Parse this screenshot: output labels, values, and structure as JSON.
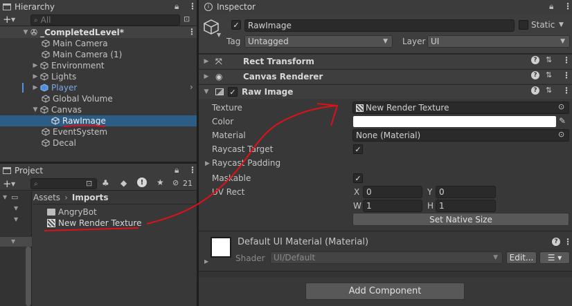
{
  "hierarchy": {
    "tab": "Hierarchy",
    "search_placeholder": "All",
    "scene": "_CompletedLevel*",
    "items": [
      {
        "label": "Main Camera"
      },
      {
        "label": "Main Camera (1)"
      },
      {
        "label": "Environment"
      },
      {
        "label": "Lights"
      },
      {
        "label": "Player"
      },
      {
        "label": "Global Volume"
      },
      {
        "label": "Canvas"
      },
      {
        "label": "RawImage"
      },
      {
        "label": "EventSystem"
      },
      {
        "label": "Decal"
      }
    ]
  },
  "project": {
    "tab": "Project",
    "hidden_count": "21",
    "breadcrumb": {
      "root": "Assets",
      "sep": "›",
      "current": "Imports"
    },
    "items": [
      {
        "label": "AngryBot"
      },
      {
        "label": "New Render Texture"
      }
    ]
  },
  "inspector": {
    "tab": "Inspector",
    "object_name": "RawImage",
    "static_label": "Static",
    "tag_label": "Tag",
    "tag_value": "Untagged",
    "layer_label": "Layer",
    "layer_value": "UI",
    "components": {
      "rect_transform": "Rect Transform",
      "canvas_renderer": "Canvas Renderer",
      "raw_image": "Raw Image"
    },
    "fields": {
      "texture_label": "Texture",
      "texture_value": "New Render Texture",
      "color_label": "Color",
      "material_label": "Material",
      "material_value": "None (Material)",
      "raycast_target_label": "Raycast Target",
      "raycast_padding_label": "Raycast Padding",
      "maskable_label": "Maskable",
      "uvrect_label": "UV Rect",
      "x_label": "X",
      "x_value": "0",
      "y_label": "Y",
      "y_value": "0",
      "w_label": "W",
      "w_value": "1",
      "h_label": "H",
      "h_value": "1"
    },
    "set_native_size": "Set Native Size",
    "material_section": {
      "title": "Default UI Material (Material)",
      "shader_label": "Shader",
      "shader_value": "UI/Default",
      "edit_label": "Edit..."
    },
    "add_component": "Add Component"
  },
  "colors": {
    "selection": "#2c5d87",
    "annotation": "#e0101a",
    "player_text": "#7ca9e8"
  }
}
